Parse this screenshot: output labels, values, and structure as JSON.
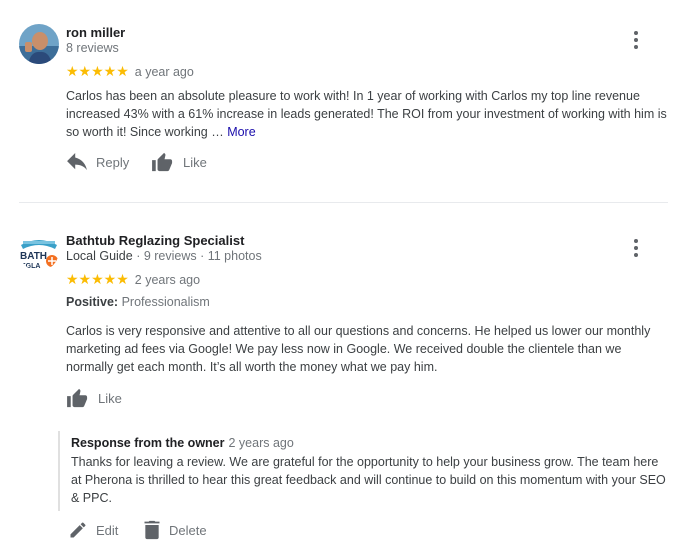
{
  "reviews": [
    {
      "author": "ron miller",
      "meta": "8 reviews",
      "stars": "★★★★★",
      "date": "a year ago",
      "text": "Carlos has been an absolute pleasure to work with!  In 1 year of working with Carlos my top line revenue increased 43% with a 61% increase in leads generated!  The ROI from your investment of working with him is so worth it!  Since working …",
      "more_label": "More",
      "reply_label": "Reply",
      "like_label": "Like"
    },
    {
      "author": "Bathtub Reglazing Specialist",
      "meta_guide": "Local Guide",
      "meta_rest": " · 9 reviews · 11 photos",
      "stars": "★★★★★",
      "date": "2 years ago",
      "positive_label": "Positive:",
      "positive_value": " Professionalism",
      "text": "Carlos is very responsive and attentive to all our questions and concerns. He helped us lower our monthly marketing ad fees via Google! We pay less now in Google. We received double the clientele than we normally get each month. It’s all worth the money what we pay him.",
      "like_label": "Like",
      "avatar_text_1": "BATH",
      "avatar_text_2": "EGLA",
      "response": {
        "title": "Response from the owner",
        "date": "2 years ago",
        "text": "Thanks for leaving a review. We are grateful for the opportunity to help your business grow. The team here at Pherona is thrilled to hear this great feedback and will continue to build on this momentum with your SEO & PPC."
      },
      "edit_label": "Edit",
      "delete_label": "Delete"
    }
  ],
  "colors": {
    "star": "#fbbc04",
    "link": "#1a0dab",
    "muted": "#70757a",
    "icon": "#5f6368"
  },
  "icons": [
    "reply-icon",
    "thumbs-up-icon",
    "pencil-icon",
    "trash-icon",
    "more-vert-icon"
  ]
}
